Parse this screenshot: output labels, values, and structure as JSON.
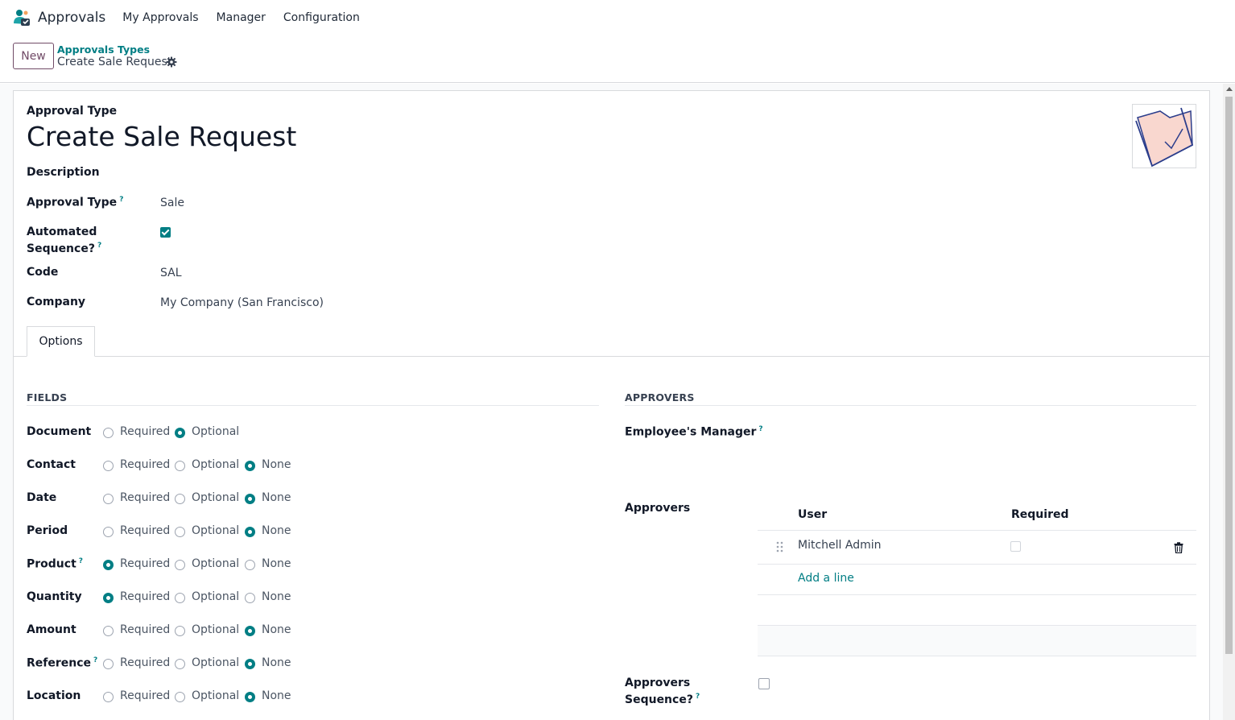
{
  "navbar": {
    "app_title": "Approvals",
    "menu": [
      "My Approvals",
      "Manager",
      "Configuration"
    ]
  },
  "control_panel": {
    "new_button": "New",
    "breadcrumb_parent": "Approvals Types",
    "breadcrumb_current": "Create Sale Request"
  },
  "form": {
    "heading": "Approval Type",
    "title": "Create Sale Request",
    "description_label": "Description",
    "approval_type_label": "Approval Type",
    "approval_type_value": "Sale",
    "automated_sequence_label_1": "Automated",
    "automated_sequence_label_2": "Sequence?",
    "automated_sequence_checked": true,
    "code_label": "Code",
    "code_value": "SAL",
    "company_label": "Company",
    "company_value": "My Company (San Francisco)",
    "help_mark": "?"
  },
  "tabs": [
    "Options"
  ],
  "fields_section": {
    "title": "FIELDS",
    "option_labels": [
      "Required",
      "Optional",
      "None"
    ],
    "rows": [
      {
        "label": "Document",
        "help": false,
        "selected": "Optional",
        "has_none": false
      },
      {
        "label": "Contact",
        "help": false,
        "selected": "None",
        "has_none": true
      },
      {
        "label": "Date",
        "help": false,
        "selected": "None",
        "has_none": true
      },
      {
        "label": "Period",
        "help": false,
        "selected": "None",
        "has_none": true
      },
      {
        "label": "Product",
        "help": true,
        "selected": "Required",
        "has_none": true
      },
      {
        "label": "Quantity",
        "help": false,
        "selected": "Required",
        "has_none": true
      },
      {
        "label": "Amount",
        "help": false,
        "selected": "None",
        "has_none": true
      },
      {
        "label": "Reference",
        "help": true,
        "selected": "None",
        "has_none": true
      },
      {
        "label": "Location",
        "help": false,
        "selected": "None",
        "has_none": true
      }
    ]
  },
  "approvers_section": {
    "title": "APPROVERS",
    "employee_manager_label": "Employee's Manager",
    "approvers_label": "Approvers",
    "columns": [
      "User",
      "Required"
    ],
    "rows": [
      {
        "user": "Mitchell Admin",
        "required": false
      }
    ],
    "add_line": "Add a line",
    "approvers_sequence_label_1": "Approvers",
    "approvers_sequence_label_2": "Sequence?",
    "approvers_sequence_checked": false
  },
  "colors": {
    "primary": "#714b67",
    "accent": "#017e84"
  }
}
